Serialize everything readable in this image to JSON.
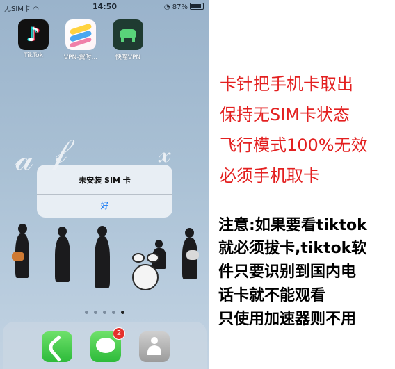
{
  "status_bar": {
    "carrier": "无SIM卡",
    "time": "14:50",
    "battery": "87%"
  },
  "apps": [
    {
      "label": "TikTok",
      "icon": "tiktok-icon"
    },
    {
      "label": "VPN-翼时...",
      "icon": "vpn-paper-plane-icon"
    },
    {
      "label": "快喵VPN",
      "icon": "cat-vpn-icon"
    }
  ],
  "alert": {
    "title": "未安装 SIM 卡",
    "ok_label": "好"
  },
  "dock": {
    "messages_badge": "2"
  },
  "annotations": {
    "red_lines": [
      "卡针把手机卡取出",
      "保持无SIM卡状态",
      "飞行模式100%无效",
      "必须手机取卡"
    ],
    "black_lines": [
      "注意:如果要看tiktok",
      "就必须拔卡,tiktok软",
      "件只要识别到国内电",
      "话卡就不能观看",
      "只使用加速器则不用"
    ]
  },
  "colors": {
    "annotation_red": "#e32020",
    "alert_button_blue": "#1a7cf5"
  }
}
